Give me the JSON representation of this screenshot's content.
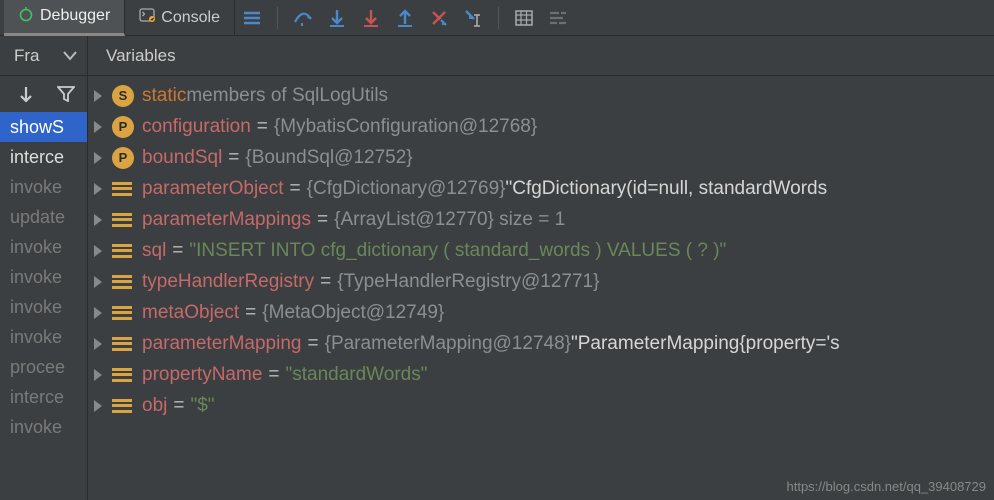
{
  "toolbar": {
    "tab_debugger": "Debugger",
    "tab_console": "Console"
  },
  "frames_panel": {
    "title": "Fra",
    "items": [
      {
        "label": "showS",
        "style": "selected"
      },
      {
        "label": "interce",
        "style": "alt"
      },
      {
        "label": "invoke",
        "style": "dim"
      },
      {
        "label": "update",
        "style": "dim"
      },
      {
        "label": "invoke",
        "style": "dim"
      },
      {
        "label": "invoke",
        "style": "dim"
      },
      {
        "label": "invoke",
        "style": "dim"
      },
      {
        "label": "invoke",
        "style": "dim"
      },
      {
        "label": "procee",
        "style": "dim"
      },
      {
        "label": "interce",
        "style": "dim"
      },
      {
        "label": "invoke",
        "style": "dim"
      }
    ]
  },
  "variables_panel": {
    "title": "Variables",
    "rows": [
      {
        "badge": "S",
        "badgeClass": "sS",
        "kind": "keyword",
        "name": "static",
        "dim": " members of SqlLogUtils"
      },
      {
        "badge": "P",
        "badgeClass": "sP",
        "kind": "var",
        "name": "configuration",
        "eq": "=",
        "dim": "{MybatisConfiguration@12768}"
      },
      {
        "badge": "P",
        "badgeClass": "sP",
        "kind": "var",
        "name": "boundSql",
        "eq": "=",
        "dim": "{BoundSql@12752}"
      },
      {
        "badge": "F",
        "badgeClass": "field",
        "kind": "var",
        "name": "parameterObject",
        "eq": "=",
        "dim": "{CfgDictionary@12769} ",
        "white": "\"CfgDictionary(id=null, standardWords"
      },
      {
        "badge": "F",
        "badgeClass": "field",
        "kind": "var",
        "name": "parameterMappings",
        "eq": "=",
        "dim": "{ArrayList@12770}  size = 1"
      },
      {
        "badge": "F",
        "badgeClass": "field",
        "kind": "var",
        "name": "sql",
        "eq": "=",
        "str": "\"INSERT INTO cfg_dictionary ( standard_words ) VALUES ( ? )\""
      },
      {
        "badge": "F",
        "badgeClass": "field",
        "kind": "var",
        "name": "typeHandlerRegistry",
        "eq": "=",
        "dim": "{TypeHandlerRegistry@12771}"
      },
      {
        "badge": "F",
        "badgeClass": "field",
        "kind": "var",
        "name": "metaObject",
        "eq": "=",
        "dim": "{MetaObject@12749}"
      },
      {
        "badge": "F",
        "badgeClass": "field",
        "kind": "var",
        "name": "parameterMapping",
        "eq": "=",
        "dim": "{ParameterMapping@12748} ",
        "white": "\"ParameterMapping{property='s"
      },
      {
        "badge": "F",
        "badgeClass": "field",
        "kind": "var",
        "name": "propertyName",
        "eq": "=",
        "str": "\"standardWords\""
      },
      {
        "badge": "F",
        "badgeClass": "field",
        "kind": "var",
        "name": "obj",
        "eq": "=",
        "str": "\"$\""
      }
    ]
  },
  "watermark": "https://blog.csdn.net/qq_39408729"
}
